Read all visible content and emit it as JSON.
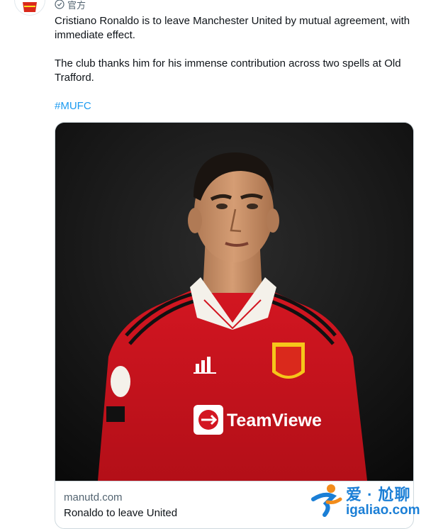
{
  "tweet": {
    "account_label": "官方",
    "verified_icon": "verified-badge-icon",
    "paragraph_1": "Cristiano Ronaldo is to leave Manchester United by mutual agreement, with immediate effect.",
    "paragraph_2": "The club thanks him for his immense contribution across two spells at Old Trafford.",
    "hashtag": "#MUFC"
  },
  "card": {
    "domain": "manutd.com",
    "title": "Ronaldo to leave United",
    "image_alt": "Cristiano Ronaldo in a red Manchester United shirt"
  },
  "watermark": {
    "brand_cn": "爱 · 尬聊",
    "url": "igaliao.com"
  },
  "colors": {
    "link_blue": "#1d9bf0",
    "text_primary": "#0f1419",
    "text_secondary": "#536471",
    "border": "#cfd9de",
    "shirt_red": "#d31621",
    "watermark_blue": "#1b7fd6",
    "watermark_orange": "#f28c1b"
  }
}
